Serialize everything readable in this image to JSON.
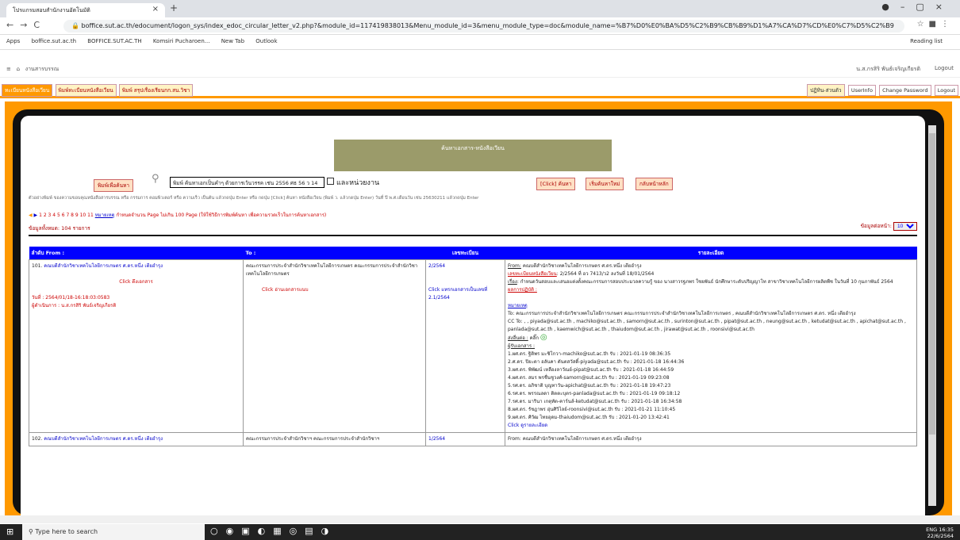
{
  "browser": {
    "tab_title": "โปรแกรมสอบสำนักงานอัตโนมัติ",
    "url_host": "boffice.sut.ac.th",
    "url_path": "/edocument/logon_sys/index_edoc_circular_letter_v2.php?&module_id=117419838013&Menu_module_id=3&menu_module_type=doc&module_name=%B7%D0%E0%BA%D5%C2%B9%CB%B9%D1%A7%CA%D7%CD%E0%C7%D5%C2%B9",
    "bookmarks": [
      "Apps",
      "boffice.sut.ac.th",
      "BOFFICE.SUT.AC.TH",
      "Komsiri Pucharoen...",
      "New Tab",
      "Outlook"
    ],
    "reading_list": "Reading list"
  },
  "app": {
    "breadcrumb": "งานสารบรรณ",
    "user": "น.ส.กรสิริ พันธ์เจริญเกียรติ",
    "logout": "Logout"
  },
  "menu": {
    "left": [
      "ทะเบียนหนังสือเวียน",
      "พิมพ์ทะเบียนหนังสือเวียน",
      "พิมพ์ สรุปเรื่องเรียนกก.สน.วิชา"
    ],
    "right": [
      "ปฏิทิน-ส่วนตัว",
      "UserInfo",
      "Change Password",
      "Logout"
    ]
  },
  "search": {
    "title": "ค้นหาเอกสาร-หนังสือเวียน",
    "print_button": "พิมพ์เพื่อค้นหา",
    "input_value": "พิมพ์ ค้นหาเอกเป็นคำๆ ด้วยการเว้นวรรค เช่น 2556 ศธ 56 ว 14",
    "checkbox_label": "และหน่วยงาน",
    "search_button": "[Click] ค้นหา",
    "reset_button": "เริ่มค้นหาใหม่",
    "home_button": "กลับหน้าหลัก",
    "hint": "ตัวอย่างพิมพ์ ของความขอบคุณหนังสือสารบรรณ หรือ กรรมการ คอมพิวเตอร์ หรือ ความเร็ว เป็นต้น แล้วกดปุ่ม Enter หรือ กดปุ่ม [Click] ค้นหา  หนังสือเวียน (พิมพ์ ว. แล้วกดปุ่ม Enter)  วันที่ ปี พ.ศ.เดือนวัน เช่น 25630211 แล้วกดปุ่ม Enter"
  },
  "pager": {
    "pages": "1 2 3 4 5 6 7 8 9 10 11",
    "note_label": "หมายเหตุ",
    "note": "กำหนดจำนวน Page ไม่เกิน 100 Page (ให้ใช้วิธีการพิมพ์ค้นหา เพื่อความรวดเร็วในการค้นหาเอกสาร)",
    "total": "ข้อมูลทั้งหมด: 104 รายการ",
    "per_page_label": "ข้อมูลต่อหน้า:",
    "per_page_value": "10"
  },
  "table": {
    "headers": [
      "ลำดับ From :",
      "To :",
      "เลขทะเบียน",
      "รายละเอียด"
    ],
    "row1": {
      "no": "101.",
      "from": "คณบดีสำนักวิชาเทคโนโลยีการเกษตร ศ.ดร.หนึ่ง เตียอำรุง",
      "open_doc": "Click ดึงเอกสาร",
      "date": "วันที่ : 2564/01/18-16:18:03:0583",
      "operator": "ผู้ดำเนินการ : น.ส.กรสิริ พันธ์เจริญเกียรติ",
      "to": "คณะกรรมการประจำสำนักวิชาเทคโนโลยีการเกษตร คณะกรรมการประจำสำนักวิชาเทคโนโลยีการเกษตร",
      "to_link": "Click อ่านเอกสารแนบ",
      "reg_no": "2/2564",
      "reg_link": "Click แทรกเอกสารเป็นเลขที่ 2.1/2564",
      "d_from_label": "From:",
      "d_from": "คณบดีสำนักวิชาเทคโนโลยีการเกษตร ศ.ดร.หนึ่ง เตียอำรุง",
      "d_reg_label": "เลขทะเบียนหนังสือเวียน",
      "d_reg": ": 2/2564 ที่ อว 7413/ว2 ลงวันที่ 18/01/2564",
      "d_subject_label": "เรื่อง",
      "d_subject": ": กำหนดวันสอบและเสนอแต่งตั้งคณะกรรมการสอบประมวลความรู้ ของ นางสาวรฐภพร ใชยพันธ์ นักศึกษาระดับปริญญาโท สาขาวิชาเทคโนโลยีการผลิตพืช ในวันที่ 10 กุมภาพันธ์ 2564",
      "d_action_label": "ผลการปฏิบัติ :",
      "d_note_label": "หมายเหตุ",
      "d_to": "To: คณะกรรมการประจำสำนักวิชาเทคโนโลยีการเกษตร คณะกรรมการประจำสำนักวิชาเทคโนโลยีการเกษตร , คณบดีสำนักวิชาเทคโนโลยีการเกษตร ศ.ดร. หนึ่ง เตียอำรุง",
      "d_cc": "CC To: , , piyada@sut.ac.th , machiko@sut.ac.th , samorn@sut.ac.th , surinton@sut.ac.th , pipat@sut.ac.th , neung@sut.ac.th , ketudat@sut.ac.th , apichat@sut.ac.th , panlada@sut.ac.th , kaemwich@sut.ac.th , thaiudom@sut.ac.th , jirawat@sut.ac.th , roonsivi@sut.ac.th",
      "d_send_label": "ส่งอื่นต่อ :",
      "d_send_click": "คลิ๊ก",
      "d_recv_label": "ผู้รับเอกสาร :",
      "receivers": [
        "1.ผศ.ดร. ฐิติพร มะชิโกวา-machiko@sut.ac.th รับ : 2021-01-19 08:36:35",
        "2.ศ.ดร. ปิยะดา อลันคา ตันตสวัสดิ์-piyada@sut.ac.th รับ : 2021-01-18 16:44:36",
        "3.ผศ.ดร. พิพัฒน์ เหลืองลาวัณย์-pipat@sut.ac.th รับ : 2021-01-18 16:44:59",
        "4.ผศ.ดร. สมร พรชื่นชูวงศ์-samorn@sut.ac.th รับ : 2021-01-19 09:23:08",
        "5.รศ.ดร. อภิชาติ บุญทาวัน-apichat@sut.ac.th รับ : 2021-01-18 19:47:23",
        "6.รศ.ดร. พรรณลดา ติตตะบุตร-panlada@sut.ac.th รับ : 2021-01-19 09:18:12",
        "7.รศ.ดร. มารินา เกตุทัต-คาร์นส์-ketudat@sut.ac.th รับ : 2021-01-18 16:34:58",
        "8.ผศ.ดร. รัชฎาพร อุ่นศิวิไลย์-roonsivi@sut.ac.th รับ : 2021-01-21 11:10:45",
        "9.ผศ.ดร. ศิวัฒ ไทยอุดม-thaiudom@sut.ac.th รับ : 2021-01-20 13:42:41"
      ],
      "d_more": "Click ดูรายละเอียด"
    },
    "row2": {
      "no": "102.",
      "from": "คณบดีสำนักวิชาเทคโนโลยีการเกษตร ศ.ดร.หนึ่ง เตียอำรุง",
      "to": "คณะกรรมการประจำสำนักวิชาฯ คณะกรรมการประจำสำนักวิชาฯ",
      "reg_no": "1/2564",
      "d_from": "From: คณบดีสำนักวิชาเทคโนโลยีการเกษตร ศ.ดร.หนึ่ง เตียอำรุง"
    }
  },
  "taskbar": {
    "search_placeholder": "Type here to search",
    "lang": "ENG",
    "time": "16:35",
    "date": "22/6/2564"
  },
  "colors": {
    "accent": "#ff9900",
    "header_blue": "#0000ff",
    "link_red": "#cc0000"
  }
}
